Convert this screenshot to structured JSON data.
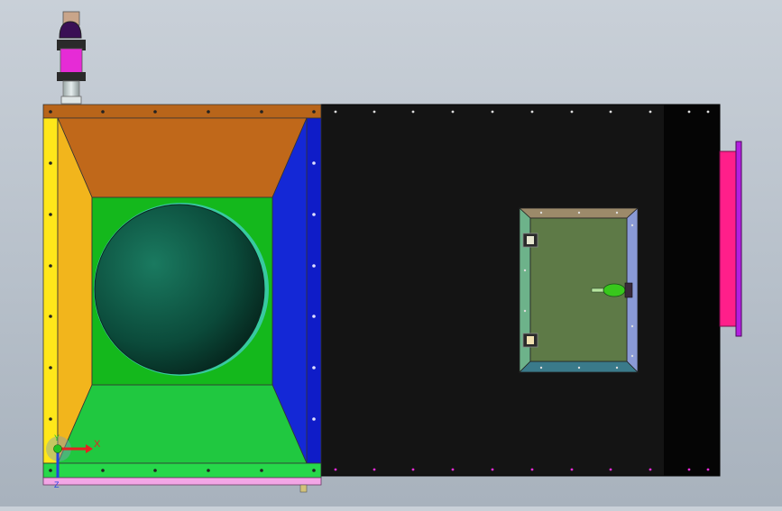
{
  "viewport": {
    "background_top": "#c9d0d8",
    "background_bottom": "#a8b2bd"
  },
  "model": {
    "housing_dark_color": "#141414",
    "top_flange_color": "#b8651a",
    "left_flange_color": "#f2b51c",
    "right_flange_color": "#1428d6",
    "bottom_flange_color": "#20c840",
    "inner_panel_color": "#14b81c",
    "opening_color": "#0f5a46",
    "inlet_flange_color": "#ff1f8a",
    "valve_accent_color": "#e62bd6",
    "access_door_color": "#5e7a47"
  },
  "triad": {
    "x_axis_label": "X",
    "y_axis_label": "Y",
    "z_axis_label": "Z",
    "x_color": "#e52222",
    "y_color": "#22c422",
    "z_color": "#2244e0"
  }
}
